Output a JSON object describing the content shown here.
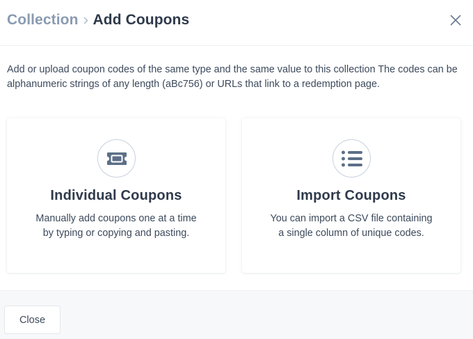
{
  "header": {
    "breadcrumb_parent": "Collection",
    "breadcrumb_separator_icon": "chevron-right-icon",
    "breadcrumb_current": "Add Coupons",
    "close_icon": "close-icon"
  },
  "description": "Add or upload coupon codes of the same type and the same value to this collection The codes can be alphanumeric strings of any length (aBc756) or URLs that link to a redemption page.",
  "options": [
    {
      "icon": "ticket-icon",
      "title": "Individual Coupons",
      "description_line1": "Manually add coupons one at a time",
      "description_line2": "by typing or copying and pasting."
    },
    {
      "icon": "list-icon",
      "title": "Import Coupons",
      "description_line1": "You can import a CSV file containing",
      "description_line2": "a single column of unique codes."
    }
  ],
  "footer": {
    "close_label": "Close"
  },
  "colors": {
    "breadcrumb_parent": "#8a9bb2",
    "text_primary": "#2f3a4b",
    "icon_stroke": "#5d6f87",
    "footer_bg": "#f7f8fa"
  }
}
